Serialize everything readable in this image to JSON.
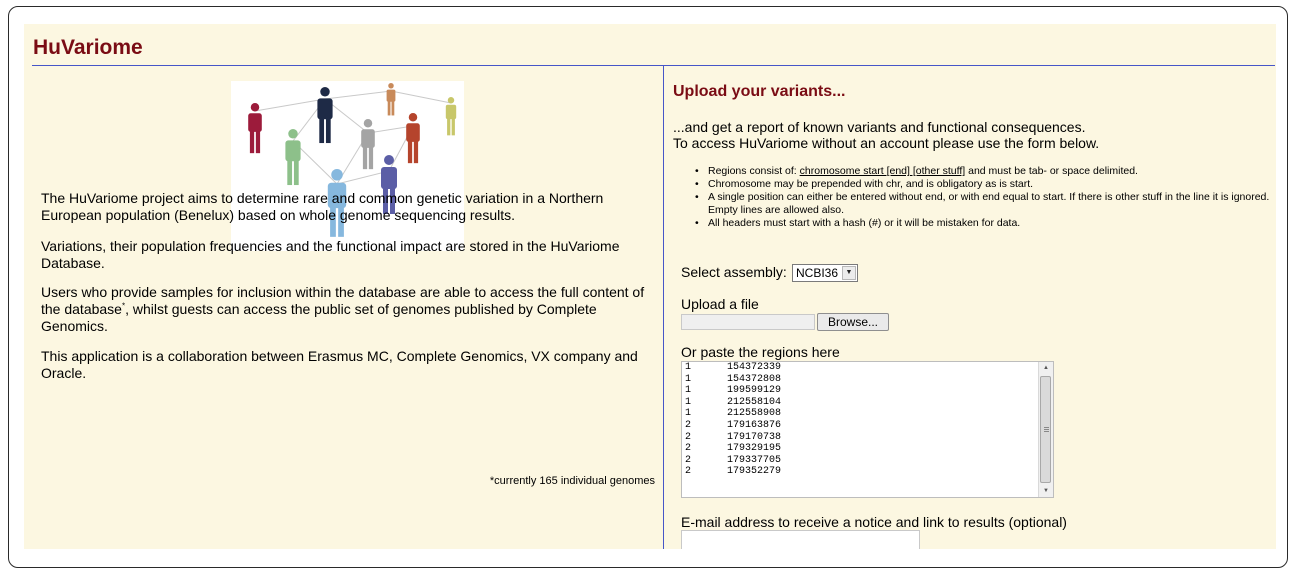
{
  "header": {
    "title": "HuVariome"
  },
  "intro": {
    "p1": "The HuVariome project aims to determine rare and common genetic variation in a Northern European population (Benelux) based on whole genome sequencing results.",
    "p2": "Variations, their population frequencies and the functional impact are stored in the HuVariome Database.",
    "p3_before": "Users who provide samples for inclusion within the database are able to access the full content of the database",
    "p3_marker": "*",
    "p3_after": ", whilst guests can access the public set of genomes published by Complete Genomics.",
    "p4": "This application is a collaboration between Erasmus MC, Complete Genomics, VX company and Oracle.",
    "footnote": "*currently 165 individual genomes"
  },
  "upload": {
    "title": "Upload your variants...",
    "lead_line1": "...and get a report of known variants and functional consequences.",
    "lead_line2": "To access HuVariome without an account please use the form below.",
    "rules": {
      "r1_prefix": "Regions consist of: ",
      "r1_format": "chromosome start [end] [other stuff]",
      "r1_suffix": " and must be tab- or space delimited.",
      "r2": "Chromosome may be prepended with chr, and is obligatory as is start.",
      "r3": "A single position can either be entered without end, or with end equal to start. If there is other stuff in the line it is ignored. Empty lines are allowed also.",
      "r4": "All headers must start with a hash (#) or it will be mistaken for data."
    },
    "assembly_label": "Select assembly:",
    "assembly_value": "NCBI36",
    "file_label": "Upload a file",
    "browse_label": "Browse...",
    "paste_label": "Or paste the regions here",
    "regions": [
      {
        "chr": "1",
        "pos": "154372339"
      },
      {
        "chr": "1",
        "pos": "154372808"
      },
      {
        "chr": "1",
        "pos": "199599129"
      },
      {
        "chr": "1",
        "pos": "212558104"
      },
      {
        "chr": "1",
        "pos": "212558908"
      },
      {
        "chr": "2",
        "pos": "179163876"
      },
      {
        "chr": "2",
        "pos": "179170738"
      },
      {
        "chr": "2",
        "pos": "179329195"
      },
      {
        "chr": "2",
        "pos": "179337705"
      },
      {
        "chr": "2",
        "pos": "179352279"
      }
    ],
    "email_label": "E-mail address to receive a notice and link to results (optional)",
    "email_value": ""
  },
  "colors": {
    "title": "#7a0c14",
    "panel": "#fcf7e1",
    "rule": "#4656c8",
    "people": [
      "#9c1b3b",
      "#8dc08a",
      "#1e2a46",
      "#86b8de",
      "#a4a4a4",
      "#5b5ea6",
      "#b5442c",
      "#c88a5a",
      "#c8c76a"
    ]
  }
}
